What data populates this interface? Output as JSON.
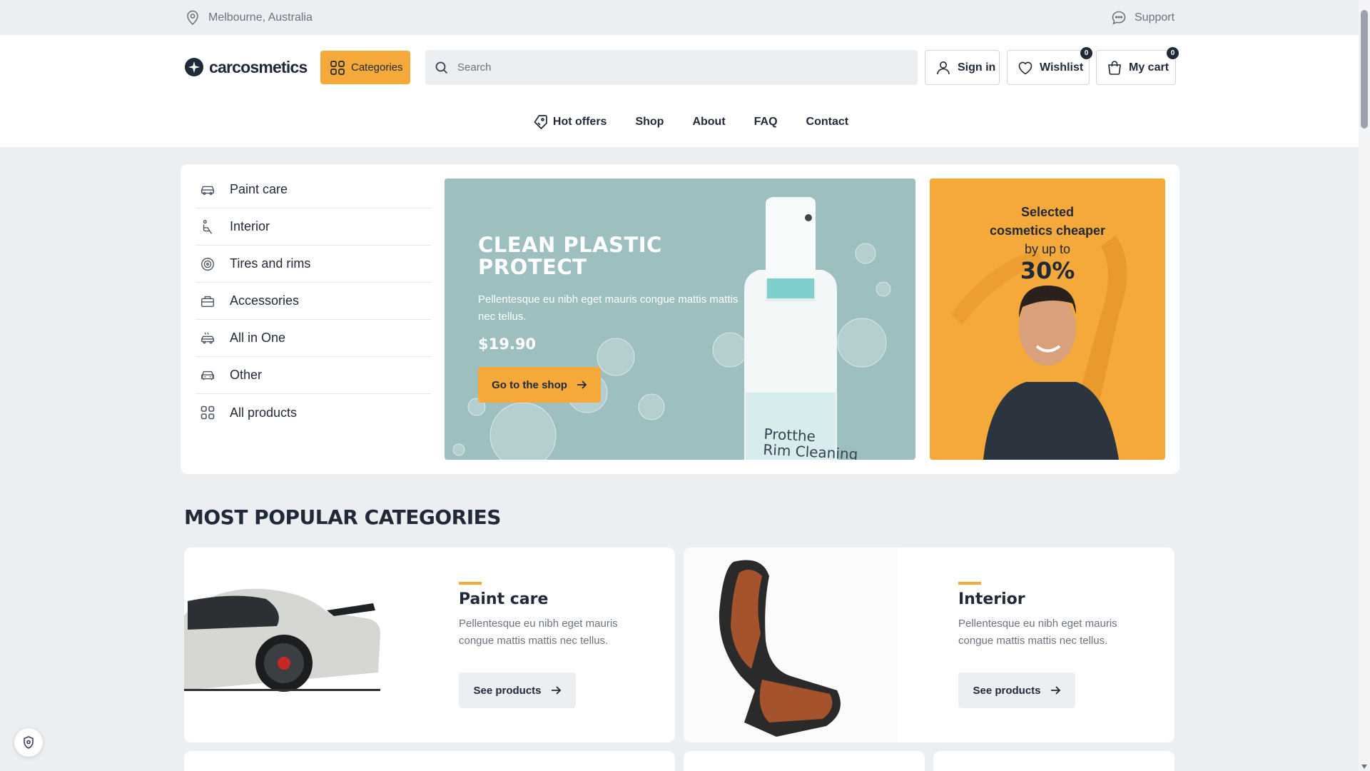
{
  "topbar": {
    "location": "Melbourne, Australia",
    "support": "Support"
  },
  "header": {
    "logo": "carcosmetics",
    "categories": "Categories",
    "search_placeholder": "Search",
    "sign_in": "Sign in",
    "wishlist": "Wishlist",
    "wishlist_count": "0",
    "cart": "My cart",
    "cart_count": "0"
  },
  "nav": [
    "Hot offers",
    "Shop",
    "About",
    "FAQ",
    "Contact"
  ],
  "sidebar": {
    "items": [
      {
        "label": "Paint care",
        "icon": "car-icon"
      },
      {
        "label": "Interior",
        "icon": "seat-icon"
      },
      {
        "label": "Tires and rims",
        "icon": "tire-icon"
      },
      {
        "label": "Accessories",
        "icon": "toolbox-icon"
      },
      {
        "label": "All in One",
        "icon": "car-wash-icon"
      },
      {
        "label": "Other",
        "icon": "car-front-icon"
      },
      {
        "label": "All products",
        "icon": "grid-icon"
      }
    ]
  },
  "banner_main": {
    "title_line1": "CLEAN PLASTIC",
    "title_line2": "PROTECT",
    "text": "Pellentesque eu nibh eget mauris congue mattis mattis nec tellus.",
    "price": "$19.90",
    "button": "Go to the shop",
    "bottle_label_line1": "Protthe",
    "bottle_label_line2": "Rim Cleaning"
  },
  "banner_promo": {
    "line1": "Selected",
    "line2": "cosmetics cheaper",
    "line3": "by up to",
    "percent": "30%"
  },
  "popular": {
    "title": "MOST POPULAR CATEGORIES",
    "cards": [
      {
        "title": "Paint care",
        "desc": "Pellentesque eu nibh eget mauris congue mattis mattis nec tellus.",
        "button": "See products"
      },
      {
        "title": "Interior",
        "desc": "Pellentesque eu nibh eget mauris congue mattis mattis nec tellus.",
        "button": "See products"
      }
    ]
  },
  "colors": {
    "accent": "#f4a93a",
    "dark": "#1f2937",
    "bg": "#ebeff2",
    "teal": "#9dbfc0"
  }
}
